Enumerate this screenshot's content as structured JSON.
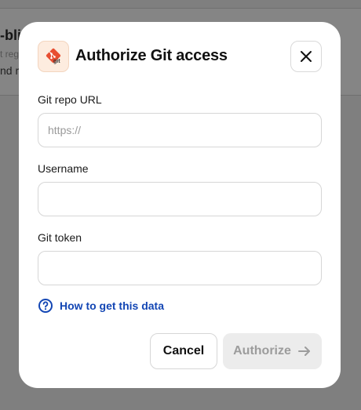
{
  "background": {
    "title_fragment": "-bli",
    "line1_fragment": "t reg",
    "line2_fragment": "nd r"
  },
  "dialog": {
    "title": "Authorize Git access",
    "logo": {
      "icon": "git-logo-icon",
      "text": "git",
      "color": "#e84e31"
    },
    "close_icon": "close-icon",
    "fields": {
      "repo_url": {
        "label": "Git repo URL",
        "placeholder": "https://",
        "value": ""
      },
      "username": {
        "label": "Username",
        "placeholder": "",
        "value": ""
      },
      "token": {
        "label": "Git token",
        "placeholder": "",
        "value": ""
      }
    },
    "help": {
      "icon": "question-circle-icon",
      "text": "How to get this data",
      "color": "#1346b4"
    },
    "buttons": {
      "cancel": "Cancel",
      "authorize": "Authorize",
      "authorize_icon": "arrow-right-icon",
      "authorize_disabled": true
    }
  }
}
